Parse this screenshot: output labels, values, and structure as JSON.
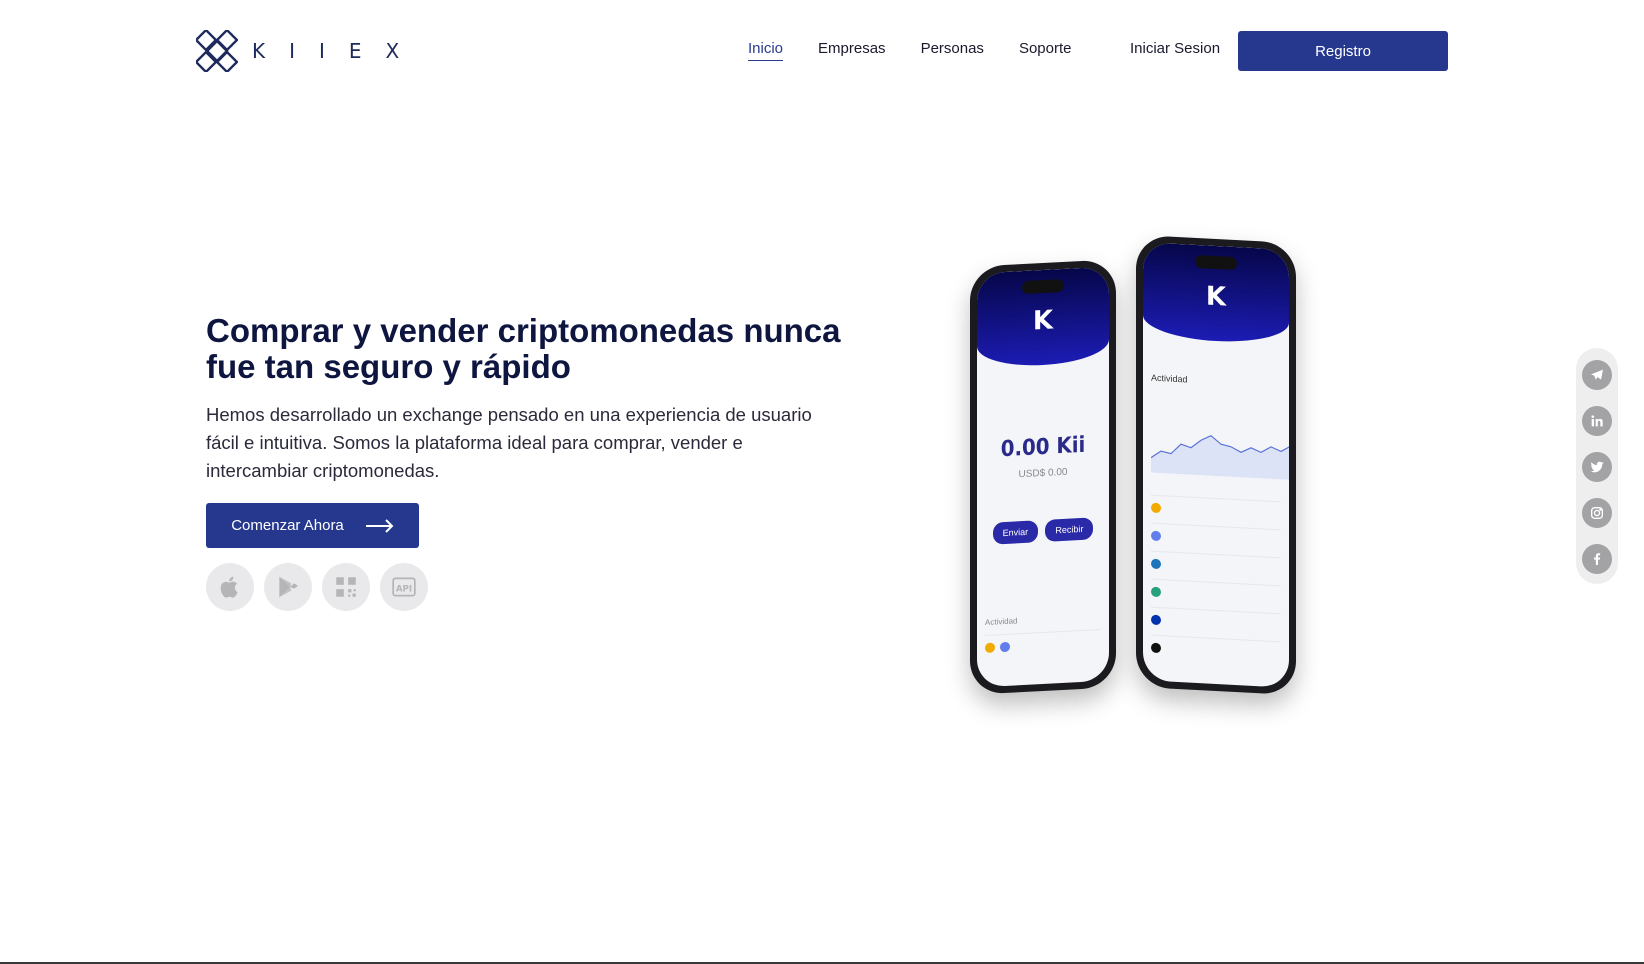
{
  "brand": {
    "name": "KIIEX"
  },
  "nav": {
    "items": [
      {
        "label": "Inicio",
        "active": true
      },
      {
        "label": "Empresas",
        "active": false
      },
      {
        "label": "Personas",
        "active": false
      },
      {
        "label": "Soporte",
        "active": false
      }
    ],
    "login_label": "Iniciar Sesion",
    "register_label": "Registro"
  },
  "hero": {
    "title": "Comprar y vender criptomonedas nunca fue tan seguro y rápido",
    "description": "Hemos desarrollado un exchange pensado en una experiencia de usuario fácil e intuitiva. Somos la plataforma ideal para comprar, vender e intercambiar criptomonedas.",
    "cta_label": "Comenzar Ahora"
  },
  "store_icons": [
    "apple-icon",
    "google-play-icon",
    "qr-code-icon",
    "api-icon"
  ],
  "phone_left": {
    "balance": "0.00 Kii",
    "balance_usd": "USD$ 0.00",
    "send_label": "Enviar",
    "receive_label": "Recibir",
    "activity_label": "Actividad"
  },
  "phone_right": {
    "activity_label": "Actividad"
  },
  "social_icons": [
    "telegram-icon",
    "linkedin-icon",
    "twitter-icon",
    "instagram-icon",
    "facebook-icon"
  ],
  "colors": {
    "primary": "#25388e",
    "title": "#0e1640",
    "social": "#a3a3a6"
  }
}
